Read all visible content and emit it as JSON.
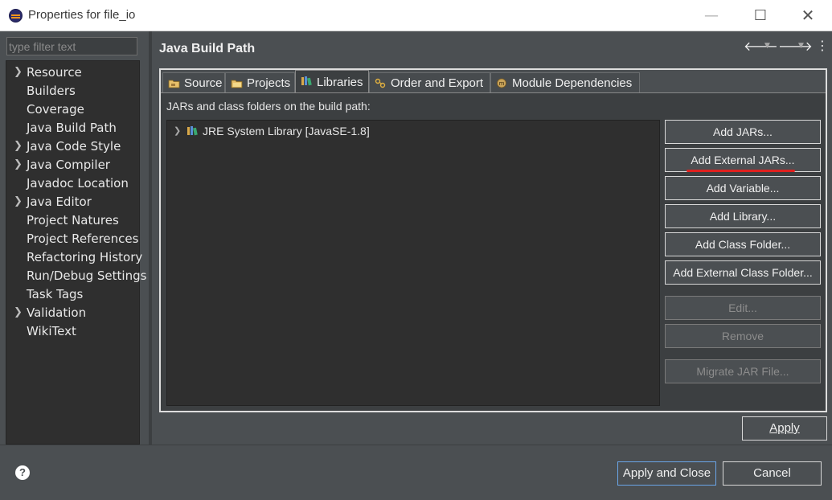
{
  "window": {
    "title": "Properties for file_io",
    "minimize_glyph": "—",
    "maximize_glyph": "☐",
    "close_glyph": "✕"
  },
  "sidebar": {
    "filter_placeholder": "type filter text",
    "items": [
      {
        "label": "Resource",
        "expandable": true
      },
      {
        "label": "Builders",
        "expandable": false
      },
      {
        "label": "Coverage",
        "expandable": false
      },
      {
        "label": "Java Build Path",
        "expandable": false
      },
      {
        "label": "Java Code Style",
        "expandable": true
      },
      {
        "label": "Java Compiler",
        "expandable": true
      },
      {
        "label": "Javadoc Location",
        "expandable": false
      },
      {
        "label": "Java Editor",
        "expandable": true
      },
      {
        "label": "Project Natures",
        "expandable": false
      },
      {
        "label": "Project References",
        "expandable": false
      },
      {
        "label": "Refactoring History",
        "expandable": false
      },
      {
        "label": "Run/Debug Settings",
        "expandable": false
      },
      {
        "label": "Task Tags",
        "expandable": false
      },
      {
        "label": "Validation",
        "expandable": true
      },
      {
        "label": "WikiText",
        "expandable": false
      }
    ]
  },
  "header": {
    "title": "Java Build Path",
    "back_glyph": "🡐",
    "forward_glyph": "🡒",
    "dropdown_glyph": "▼",
    "menu_glyph": "⋮"
  },
  "tabs": [
    {
      "label": "Source",
      "icon": "source-folder-icon",
      "active": false
    },
    {
      "label": "Projects",
      "icon": "projects-folder-icon",
      "active": false
    },
    {
      "label": "Libraries",
      "icon": "libraries-icon",
      "active": true
    },
    {
      "label": "Order and Export",
      "icon": "order-export-icon",
      "active": false
    },
    {
      "label": "Module Dependencies",
      "icon": "module-icon",
      "active": false
    }
  ],
  "libraries": {
    "caption": "JARs and class folders on the build path:",
    "items": [
      {
        "label": "JRE System Library [JavaSE-1.8]",
        "icon": "jre-library-icon"
      }
    ]
  },
  "buttons": {
    "add_jars": "Add JARs...",
    "add_external_jars": "Add External JARs...",
    "add_variable": "Add Variable...",
    "add_library": "Add Library...",
    "add_class_folder": "Add Class Folder...",
    "add_external_class_folder": "Add External Class Folder...",
    "edit": "Edit...",
    "remove": "Remove",
    "migrate_jar": "Migrate JAR File...",
    "apply": "Apply",
    "apply_and_close": "Apply and Close",
    "cancel": "Cancel",
    "help": "?"
  },
  "colors": {
    "annotation_underline": "#e0201e",
    "focus_border": "#6aa5e8",
    "background": "#4b4f52"
  }
}
